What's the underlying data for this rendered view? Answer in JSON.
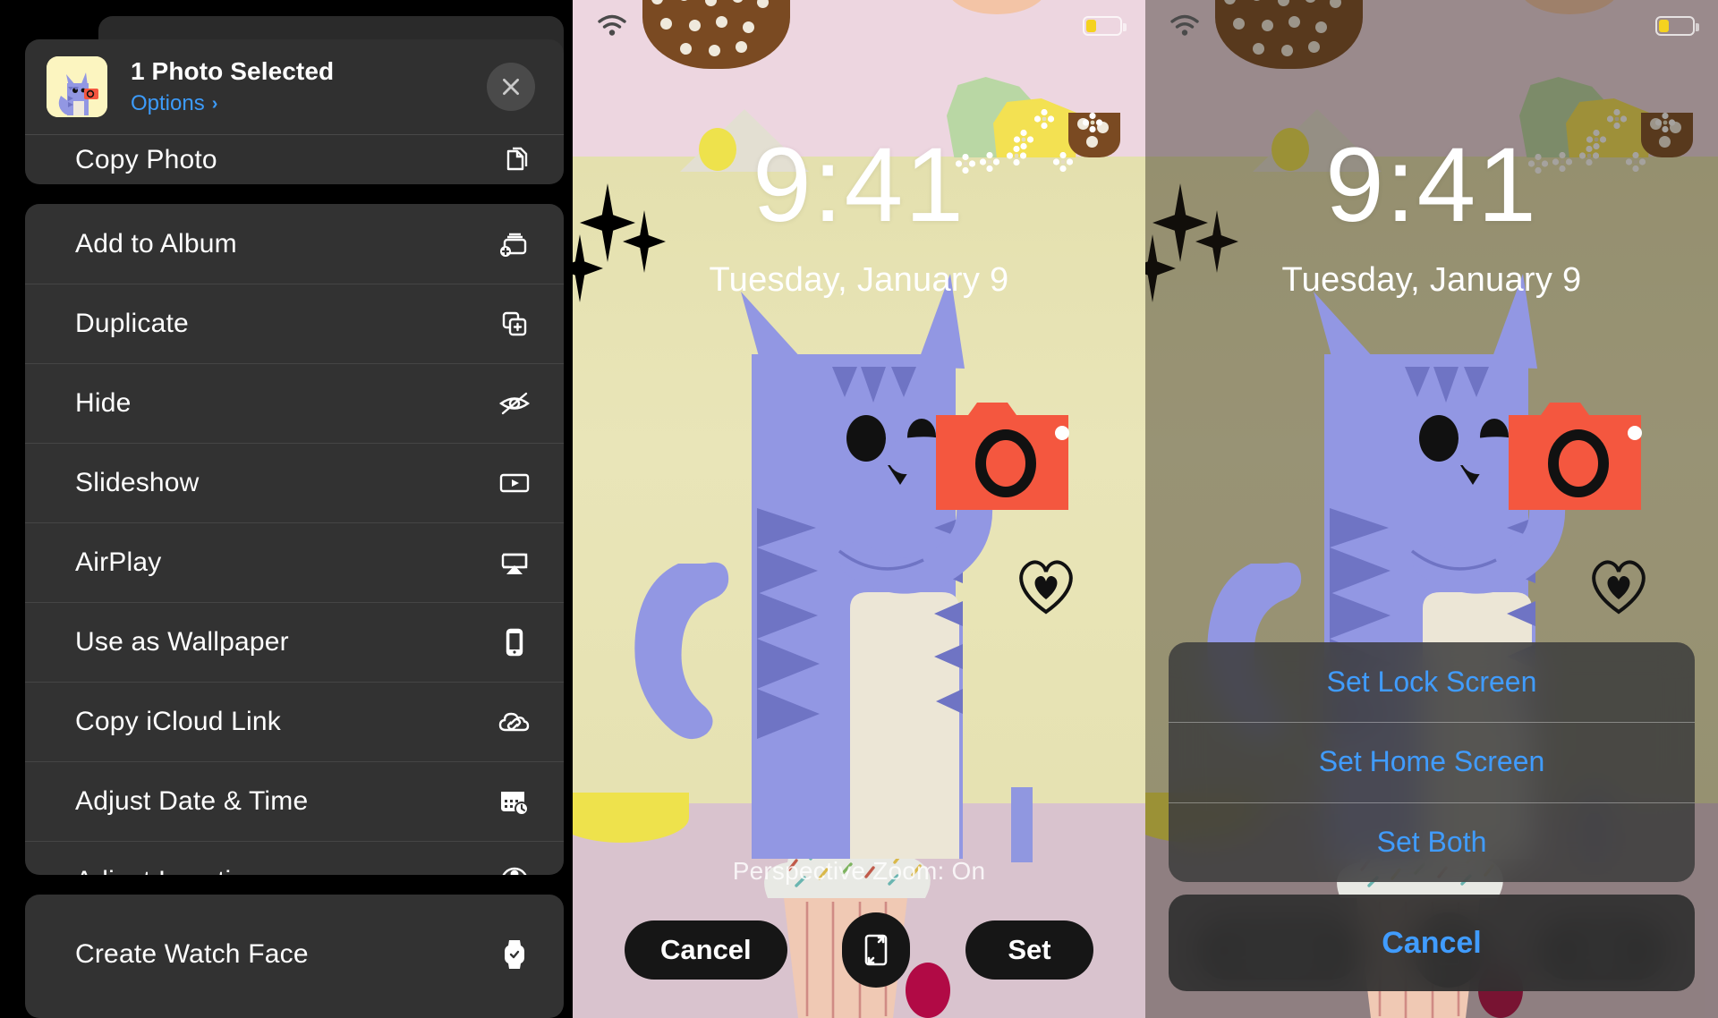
{
  "menu": {
    "header": {
      "title": "1 Photo Selected",
      "options_label": "Options",
      "options_chevron": "›",
      "thumbnail_icon": "photo-thumbnail-cat",
      "close_icon": "close-icon"
    },
    "groups": [
      {
        "id": "copy",
        "items": [
          {
            "label": "Copy Photo",
            "icon": "copy-photo-icon"
          }
        ]
      },
      {
        "id": "actions",
        "items": [
          {
            "label": "Add to Album",
            "icon": "add-to-album-icon"
          },
          {
            "label": "Duplicate",
            "icon": "duplicate-icon"
          },
          {
            "label": "Hide",
            "icon": "hide-eye-slash-icon"
          },
          {
            "label": "Slideshow",
            "icon": "slideshow-play-icon"
          },
          {
            "label": "AirPlay",
            "icon": "airplay-icon"
          },
          {
            "label": "Use as Wallpaper",
            "icon": "iphone-icon"
          },
          {
            "label": "Copy iCloud Link",
            "icon": "icloud-link-icon"
          },
          {
            "label": "Adjust Date & Time",
            "icon": "calendar-clock-icon"
          },
          {
            "label": "Adjust Location",
            "icon": "location-pin-circle-icon"
          }
        ]
      },
      {
        "id": "watch",
        "items": [
          {
            "label": "Create Watch Face",
            "icon": "apple-watch-icon"
          }
        ]
      }
    ]
  },
  "preview": {
    "status": {
      "wifi_icon": "wifi-icon",
      "battery_icon": "battery-low-icon",
      "battery_level": "20%"
    },
    "clock": "9:41",
    "date": "Tuesday, January 9",
    "perspective_zoom_label": "Perspective Zoom: On",
    "cancel_label": "Cancel",
    "set_label": "Set",
    "perspective_toggle_icon": "perspective-zoom-icon"
  },
  "action_sheet": {
    "options": [
      {
        "label": "Set Lock Screen"
      },
      {
        "label": "Set Home Screen"
      },
      {
        "label": "Set Both"
      }
    ],
    "cancel_label": "Cancel"
  },
  "colors": {
    "accent_blue": "#409cff",
    "link_blue": "#3c9bfa",
    "menu_bg": "#323232",
    "sky": "#edd6e0",
    "ground": "#e6e2b2",
    "floor": "#d9c3ce",
    "cat_body": "#9297e3",
    "cat_stripe": "#6f74c4",
    "camera_red": "#f4573f"
  }
}
